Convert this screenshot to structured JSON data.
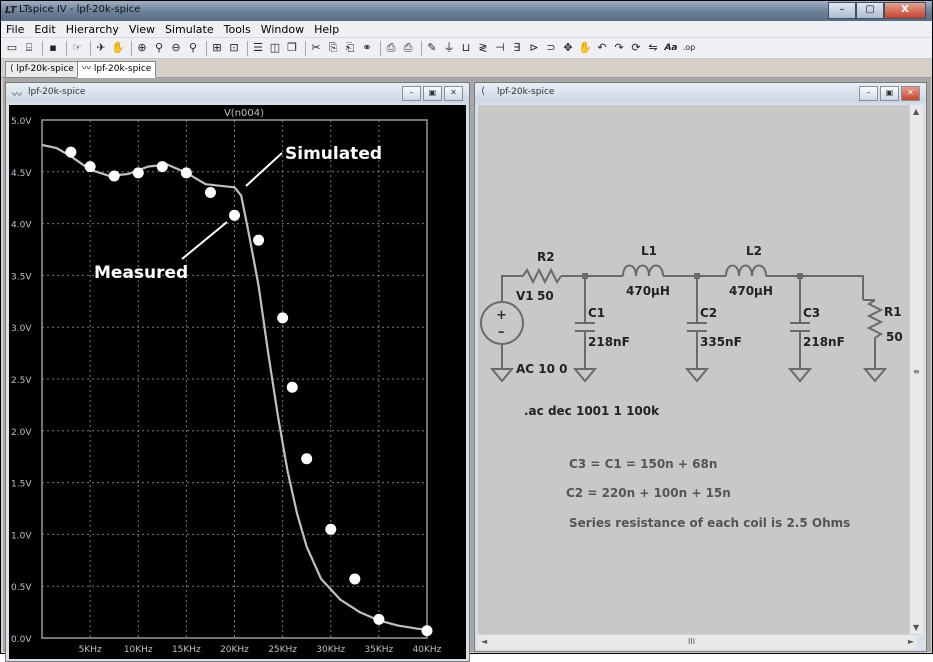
{
  "app": {
    "icon": "ltspice-icon",
    "title": "LTspice IV - lpf-20k-spice",
    "window_buttons": [
      "–",
      "▢",
      "X"
    ]
  },
  "menu": [
    "File",
    "Edit",
    "Hierarchy",
    "View",
    "Simulate",
    "Tools",
    "Window",
    "Help"
  ],
  "toolbar_icons": [
    "new-schematic-icon",
    "open-icon",
    "save-icon",
    "control-panel-icon",
    "run-icon",
    "halt-icon",
    "zoom-in-icon",
    "zoom-pan-icon",
    "zoom-out-icon",
    "zoom-fit-icon",
    "autorange-icon",
    "mark-icon",
    "tile-horizontal-icon",
    "tile-vertical-icon",
    "cascade-icon",
    "cut-icon",
    "copy-icon",
    "paste-icon",
    "find-icon",
    "print-setup-icon",
    "print-icon",
    "wire-icon",
    "ground-icon",
    "label-icon",
    "resistor-icon",
    "capacitor-icon",
    "inductor-icon",
    "diode-icon",
    "component-icon",
    "move-icon",
    "drag-icon",
    "undo-icon",
    "redo-icon",
    "rotate-icon",
    "mirror-icon",
    "text-icon",
    "spice-directive-icon"
  ],
  "toolbar_text": {
    "text_tool": "Aa",
    "spice_directive": ".op"
  },
  "tabs": [
    {
      "label": "lpf-20k-spice",
      "icon": "schematic-icon",
      "active": false
    },
    {
      "label": "lpf-20k-spice",
      "icon": "waveform-icon",
      "active": true
    }
  ],
  "plot_window": {
    "title": "lpf-20k-spice",
    "trace_name": "V(n004)",
    "annotations": {
      "simulated": "Simulated",
      "measured": "Measured"
    }
  },
  "schematic_window": {
    "title": "lpf-20k-spice",
    "components": {
      "r2": {
        "name": "R2",
        "value": "50"
      },
      "l1": {
        "name": "L1",
        "value": "470µH"
      },
      "l2": {
        "name": "L2",
        "value": "470µH"
      },
      "v1": {
        "name": "V1",
        "value": "AC 10 0"
      },
      "c1": {
        "name": "C1",
        "value": "218nF"
      },
      "c2": {
        "name": "C2",
        "value": "335nF"
      },
      "c3": {
        "name": "C3",
        "value": "218nF"
      },
      "r1": {
        "name": "R1",
        "value": "50"
      }
    },
    "directive": ".ac dec 1001 1 100k",
    "notes": [
      "C3 = C1 = 150n + 68n",
      "C2 = 220n + 100n + 15n",
      "Series resistance of each coil is 2.5 Ohms"
    ],
    "scroll": {
      "up": "▲",
      "down": "▼",
      "left": "◄",
      "right": "►",
      "grip": "III",
      "grip_v": "≡"
    }
  },
  "colors": {
    "plot_bg": "#000000",
    "grid": "#7a7a7a",
    "trace": "#c0c0c0",
    "markers": "#ffffff",
    "schematic_bg": "#c8c8c8",
    "wire": "#6a6a6a",
    "note_text": "#555555"
  },
  "chart_data": {
    "type": "line",
    "title": "V(n004)",
    "xlabel": "",
    "ylabel": "",
    "xlim": [
      0,
      40
    ],
    "ylim": [
      0,
      5
    ],
    "x_ticks": [
      "5KHz",
      "10KHz",
      "15KHz",
      "20KHz",
      "25KHz",
      "30KHz",
      "35KHz",
      "40KHz"
    ],
    "x_tick_values": [
      5,
      10,
      15,
      20,
      25,
      30,
      35,
      40
    ],
    "y_ticks": [
      "0.0V",
      "0.5V",
      "1.0V",
      "1.5V",
      "2.0V",
      "2.5V",
      "3.0V",
      "3.5V",
      "4.0V",
      "4.5V",
      "5.0V"
    ],
    "y_tick_values": [
      0,
      0.5,
      1,
      1.5,
      2,
      2.5,
      3,
      3.5,
      4,
      4.5,
      5
    ],
    "grid": true,
    "series": [
      {
        "name": "Simulated",
        "x": [
          0,
          1.5,
          3,
          5,
          7,
          9,
          11,
          13,
          15,
          17,
          19,
          20,
          20.7,
          21.5,
          22.5,
          23.5,
          24.5,
          25.5,
          26.5,
          27.5,
          29,
          31,
          33,
          35,
          37,
          39,
          40
        ],
        "values": [
          4.76,
          4.73,
          4.65,
          4.52,
          4.46,
          4.48,
          4.55,
          4.57,
          4.49,
          4.38,
          4.36,
          4.35,
          4.27,
          3.9,
          3.4,
          2.75,
          2.15,
          1.62,
          1.2,
          0.88,
          0.57,
          0.37,
          0.25,
          0.17,
          0.12,
          0.09,
          0.08
        ]
      },
      {
        "name": "Measured",
        "x": [
          3,
          5,
          7.5,
          10,
          12.5,
          15,
          17.5,
          20,
          22.5,
          25,
          26,
          27.5,
          30,
          32.5,
          35,
          40
        ],
        "values": [
          4.69,
          4.55,
          4.46,
          4.49,
          4.55,
          4.49,
          4.3,
          4.08,
          3.84,
          3.09,
          2.42,
          1.73,
          1.05,
          0.57,
          0.18,
          0.07
        ]
      }
    ]
  }
}
